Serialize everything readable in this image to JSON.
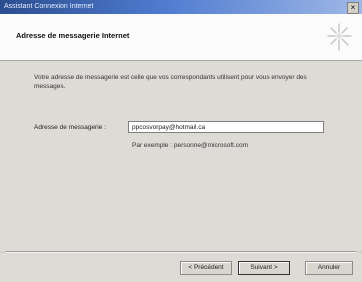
{
  "window": {
    "title": "Assistant Connexion Internet",
    "close_glyph": "×"
  },
  "header": {
    "title": "Adresse de messagerie Internet",
    "icon": "wizard-starburst-icon"
  },
  "main": {
    "description": "Votre adresse de messagerie est celle que vos correspondants utilisent pour vous envoyer des messages.",
    "email_label": "Adresse de messagerie :",
    "email_value": "ppcosvorpay@hotmail.ca",
    "example": "Par exemple : personne@microsoft.com"
  },
  "footer": {
    "prev_label": "< Précédent",
    "next_label": "Suivant >",
    "cancel_label": "Annuler"
  }
}
